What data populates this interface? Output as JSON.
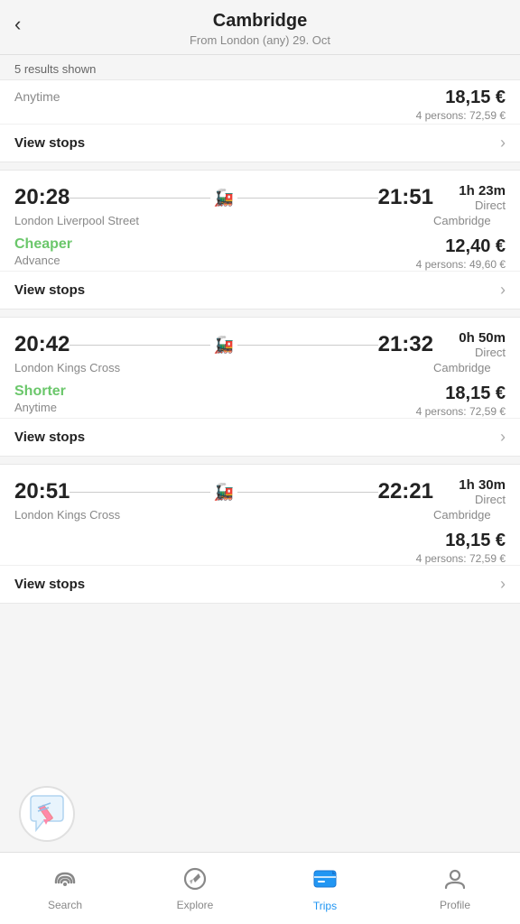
{
  "header": {
    "back_label": "‹",
    "title": "Cambridge",
    "subtitle": "From London (any) 29. Oct"
  },
  "results_count": "5 results shown",
  "cards": [
    {
      "id": "card-partial",
      "partial": true,
      "ticket_type": "Anytime",
      "price": "18,15 €",
      "price_persons": "4 persons: 72,59 €",
      "view_stops_label": "View stops"
    },
    {
      "id": "card-liverpool",
      "depart_time": "20:28",
      "arrive_time": "21:51",
      "from_station": "London Liverpool Street",
      "to_station": "Cambridge",
      "duration": "1h 23m",
      "direct": "Direct",
      "badge_label": "Cheaper",
      "badge_class": "badge-cheaper",
      "ticket_type": "Advance",
      "price": "12,40 €",
      "price_persons": "4 persons: 49,60 €",
      "view_stops_label": "View stops"
    },
    {
      "id": "card-kings-cross-1",
      "depart_time": "20:42",
      "arrive_time": "21:32",
      "from_station": "London Kings Cross",
      "to_station": "Cambridge",
      "duration": "0h 50m",
      "direct": "Direct",
      "badge_label": "Shorter",
      "badge_class": "badge-shorter",
      "ticket_type": "Anytime",
      "price": "18,15 €",
      "price_persons": "4 persons: 72,59 €",
      "view_stops_label": "View stops"
    },
    {
      "id": "card-kings-cross-2",
      "depart_time": "20:51",
      "arrive_time": "22:21",
      "from_station": "London Kings Cross",
      "to_station": "Cambridge",
      "duration": "1h 30m",
      "direct": "Direct",
      "badge_label": "",
      "badge_class": "",
      "ticket_type": "",
      "price": "18,15 €",
      "price_persons": "4 persons: 72,59 €",
      "view_stops_label": "View stops"
    }
  ],
  "bottom_nav": {
    "items": [
      {
        "id": "search",
        "label": "Search",
        "icon": "search",
        "active": false
      },
      {
        "id": "explore",
        "label": "Explore",
        "icon": "explore",
        "active": false
      },
      {
        "id": "trips",
        "label": "Trips",
        "icon": "trips",
        "active": true
      },
      {
        "id": "profile",
        "label": "Profile",
        "icon": "profile",
        "active": false
      }
    ]
  }
}
